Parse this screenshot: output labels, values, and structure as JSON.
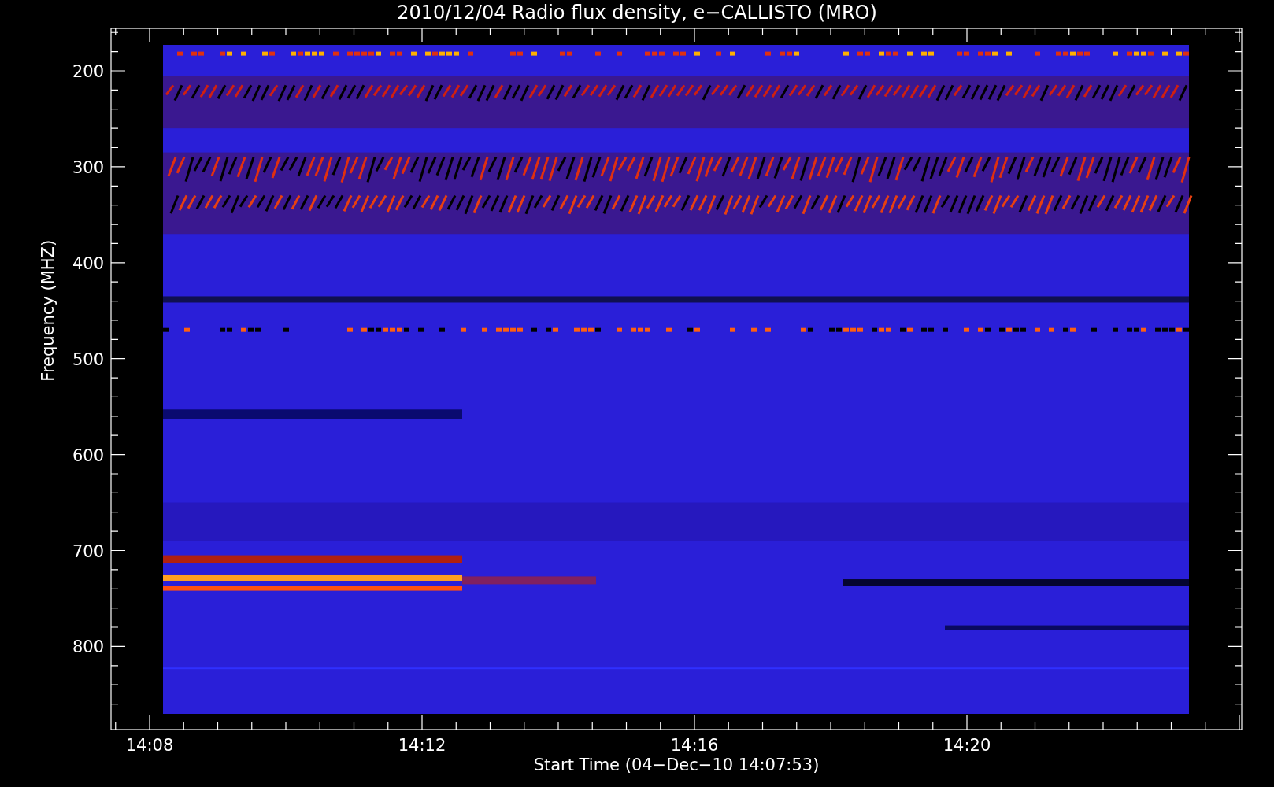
{
  "title": "2010/12/04  Radio flux density, e−CALLISTO (MRO)",
  "y_axis": {
    "label": "Frequency (MHZ)",
    "ticks": [
      "200",
      "300",
      "400",
      "500",
      "600",
      "700",
      "800"
    ]
  },
  "x_axis": {
    "label": "Start Time (04−Dec−10 14:07:53)",
    "ticks": [
      "14:08",
      "14:12",
      "14:16",
      "14:20"
    ]
  }
}
